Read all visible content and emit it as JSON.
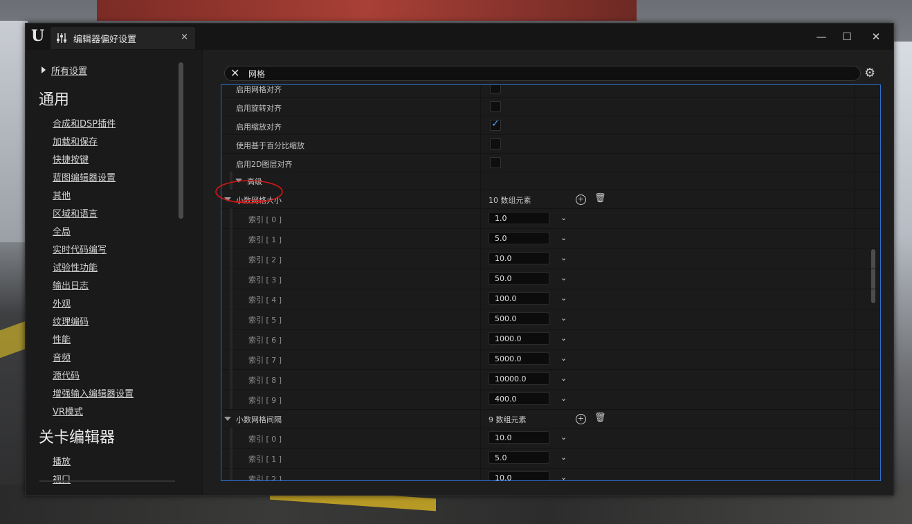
{
  "window": {
    "tab_title": "编辑器偏好设置",
    "tab_close": "×",
    "min_icon": "—",
    "max_icon": "☐",
    "close_icon": "✕"
  },
  "sidebar": {
    "all_settings": "所有设置",
    "sections": [
      {
        "title": "通用",
        "items": [
          "合成和DSP插件",
          "加载和保存",
          "快捷按键",
          "蓝图编辑器设置",
          "其他",
          "区域和语言",
          "全局",
          "实时代码编写",
          "试验性功能",
          "输出日志",
          "外观",
          "纹理编码",
          "性能",
          "音频",
          "源代码",
          "增强输入编辑器设置",
          "VR模式"
        ]
      },
      {
        "title": "关卡编辑器",
        "items": [
          "播放",
          "视口"
        ]
      }
    ]
  },
  "search": {
    "value": "网格"
  },
  "settings_rows": [
    {
      "label": "启用网格对齐",
      "checked": false
    },
    {
      "label": "启用旋转对齐",
      "checked": false
    },
    {
      "label": "启用缩放对齐",
      "checked": true
    },
    {
      "label": "使用基于百分比缩放",
      "checked": false
    },
    {
      "label": "启用2D图层对齐",
      "checked": false
    }
  ],
  "advanced_label": "高级",
  "arrays": [
    {
      "label": "小数网格大小",
      "count_text": "10 数组元素",
      "items": [
        {
          "index": "索引 [ 0 ]",
          "value": "1.0"
        },
        {
          "index": "索引 [ 1 ]",
          "value": "5.0"
        },
        {
          "index": "索引 [ 2 ]",
          "value": "10.0"
        },
        {
          "index": "索引 [ 3 ]",
          "value": "50.0"
        },
        {
          "index": "索引 [ 4 ]",
          "value": "100.0"
        },
        {
          "index": "索引 [ 5 ]",
          "value": "500.0"
        },
        {
          "index": "索引 [ 6 ]",
          "value": "1000.0"
        },
        {
          "index": "索引 [ 7 ]",
          "value": "5000.0"
        },
        {
          "index": "索引 [ 8 ]",
          "value": "10000.0"
        },
        {
          "index": "索引 [ 9 ]",
          "value": "400.0"
        }
      ]
    },
    {
      "label": "小数网格间隔",
      "count_text": "9 数组元素",
      "items": [
        {
          "index": "索引 [ 0 ]",
          "value": "10.0"
        },
        {
          "index": "索引 [ 1 ]",
          "value": "5.0"
        },
        {
          "index": "索引 [ 2 ]",
          "value": "10.0"
        }
      ]
    }
  ],
  "icons": {
    "logo": "unreal-logo-icon",
    "tab": "sliders-icon",
    "search_clear": "close-icon",
    "settings": "gear-icon",
    "add": "add-circle-icon",
    "delete": "trash-icon",
    "dropdown": "chevron-down-icon"
  },
  "colors": {
    "accent": "#2f6fd0",
    "checkbox_check": "#4da3ff",
    "annotation": "#d01818"
  }
}
